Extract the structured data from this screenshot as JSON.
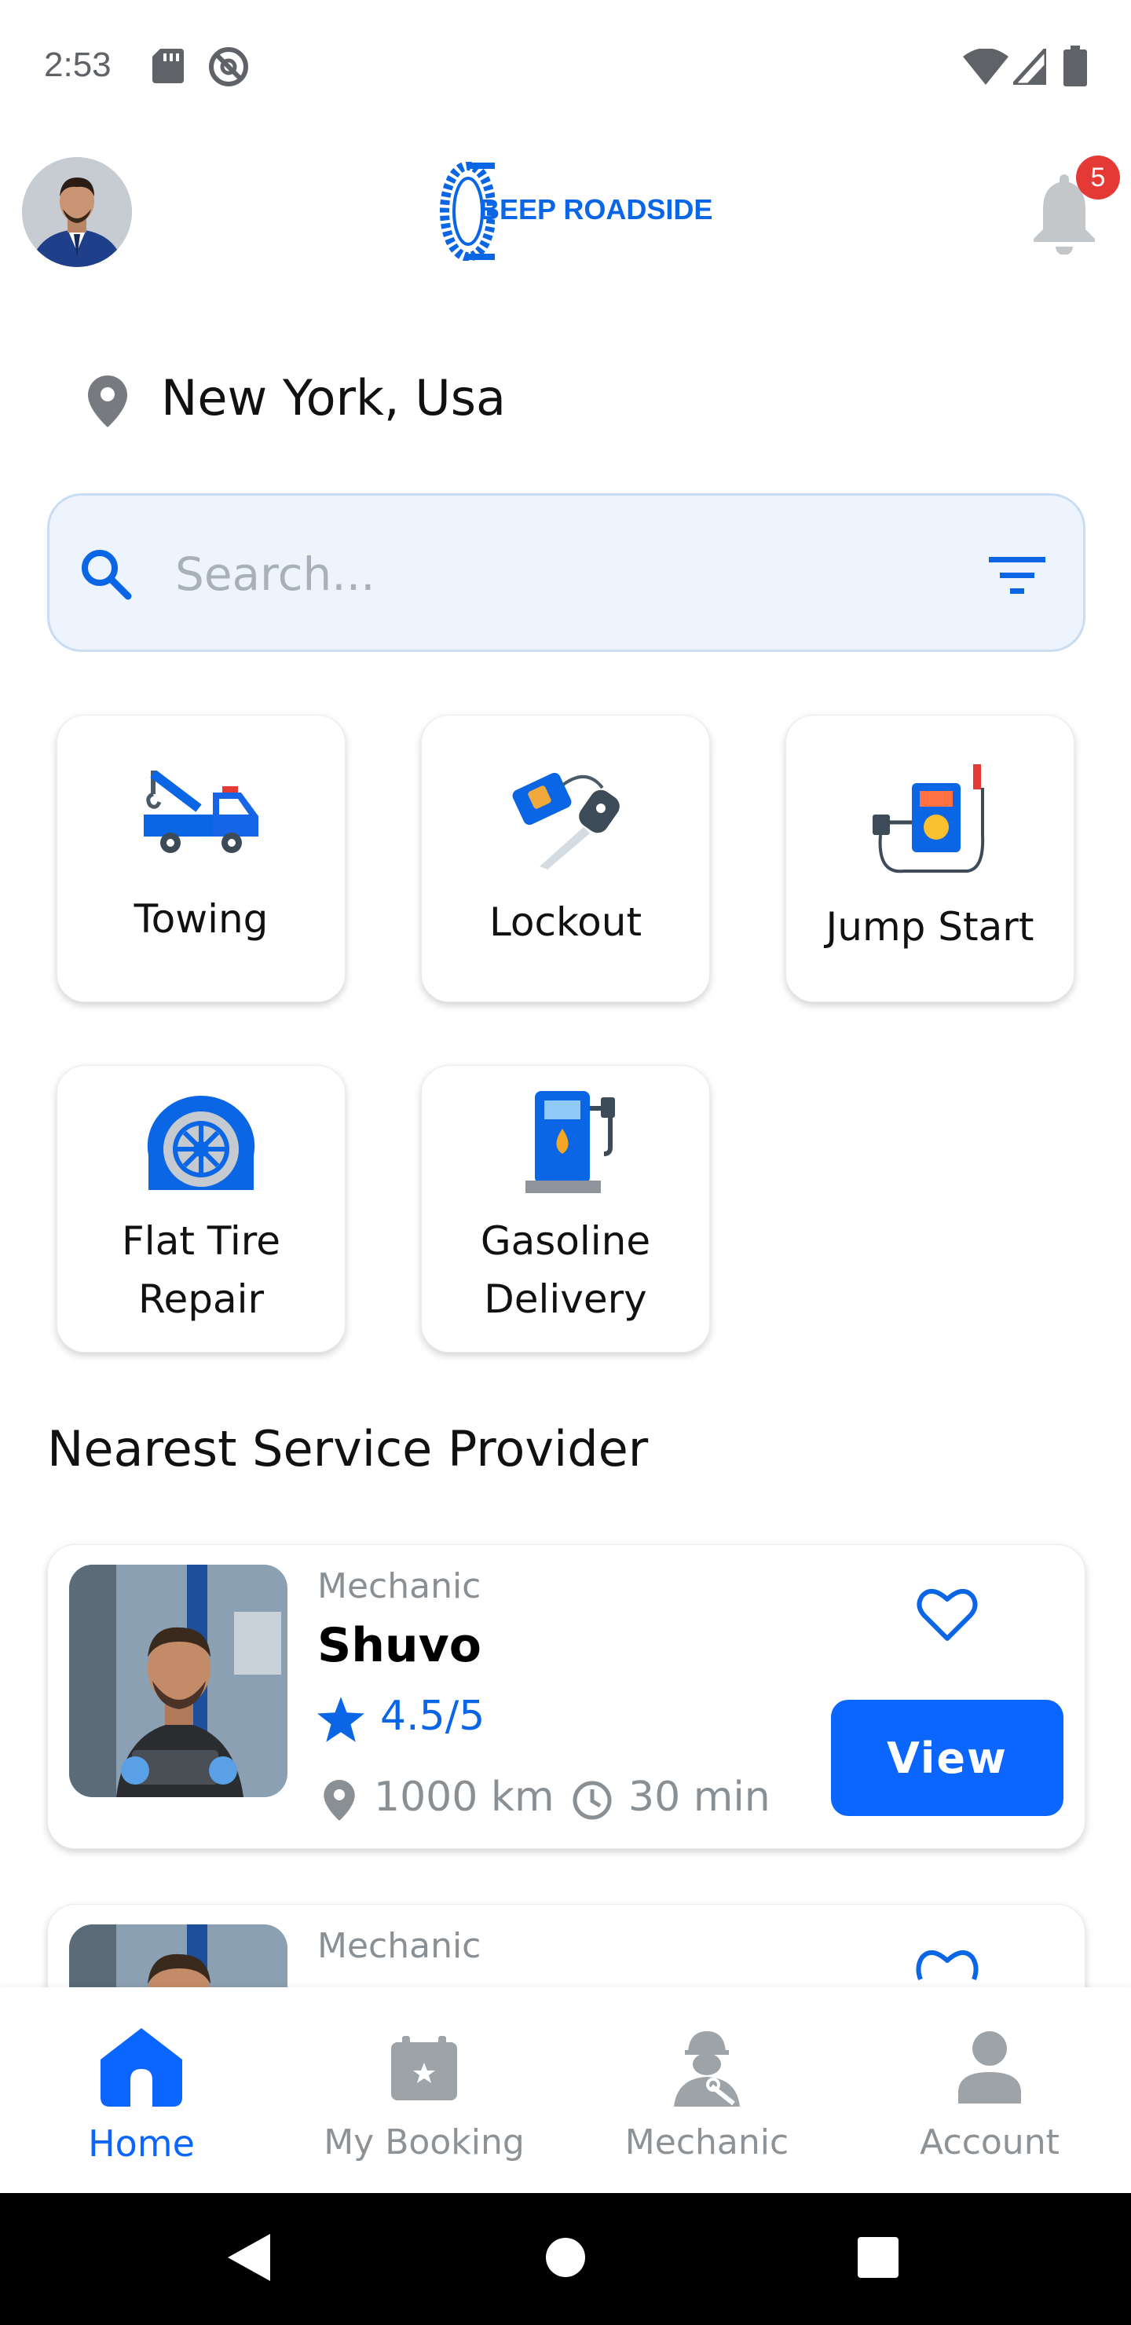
{
  "status_bar": {
    "time": "2:53"
  },
  "header": {
    "logo_text": "BEEP ROADSIDE",
    "notification_count": "5"
  },
  "location": {
    "text": "New York, Usa"
  },
  "search": {
    "placeholder": "Search..."
  },
  "services": [
    {
      "label": "Towing"
    },
    {
      "label": "Lockout"
    },
    {
      "label": "Jump Start"
    },
    {
      "label_line1": "Flat Tire",
      "label_line2": "Repair"
    },
    {
      "label_line1": "Gasoline",
      "label_line2": "Delivery"
    }
  ],
  "section_title": "Nearest Service Provider",
  "providers": [
    {
      "role": "Mechanic",
      "name": "Shuvo",
      "rating": "4.5/5",
      "distance": "1000 km",
      "time": "30 min",
      "button": "View"
    },
    {
      "role": "Mechanic"
    }
  ],
  "bottom_nav": [
    {
      "label": "Home",
      "active": true
    },
    {
      "label": "My Booking",
      "active": false
    },
    {
      "label": "Mechanic",
      "active": false
    },
    {
      "label": "Account",
      "active": false
    }
  ],
  "colors": {
    "accent": "#0a66ff",
    "badge": "#e53935",
    "muted": "#8a8f94"
  }
}
